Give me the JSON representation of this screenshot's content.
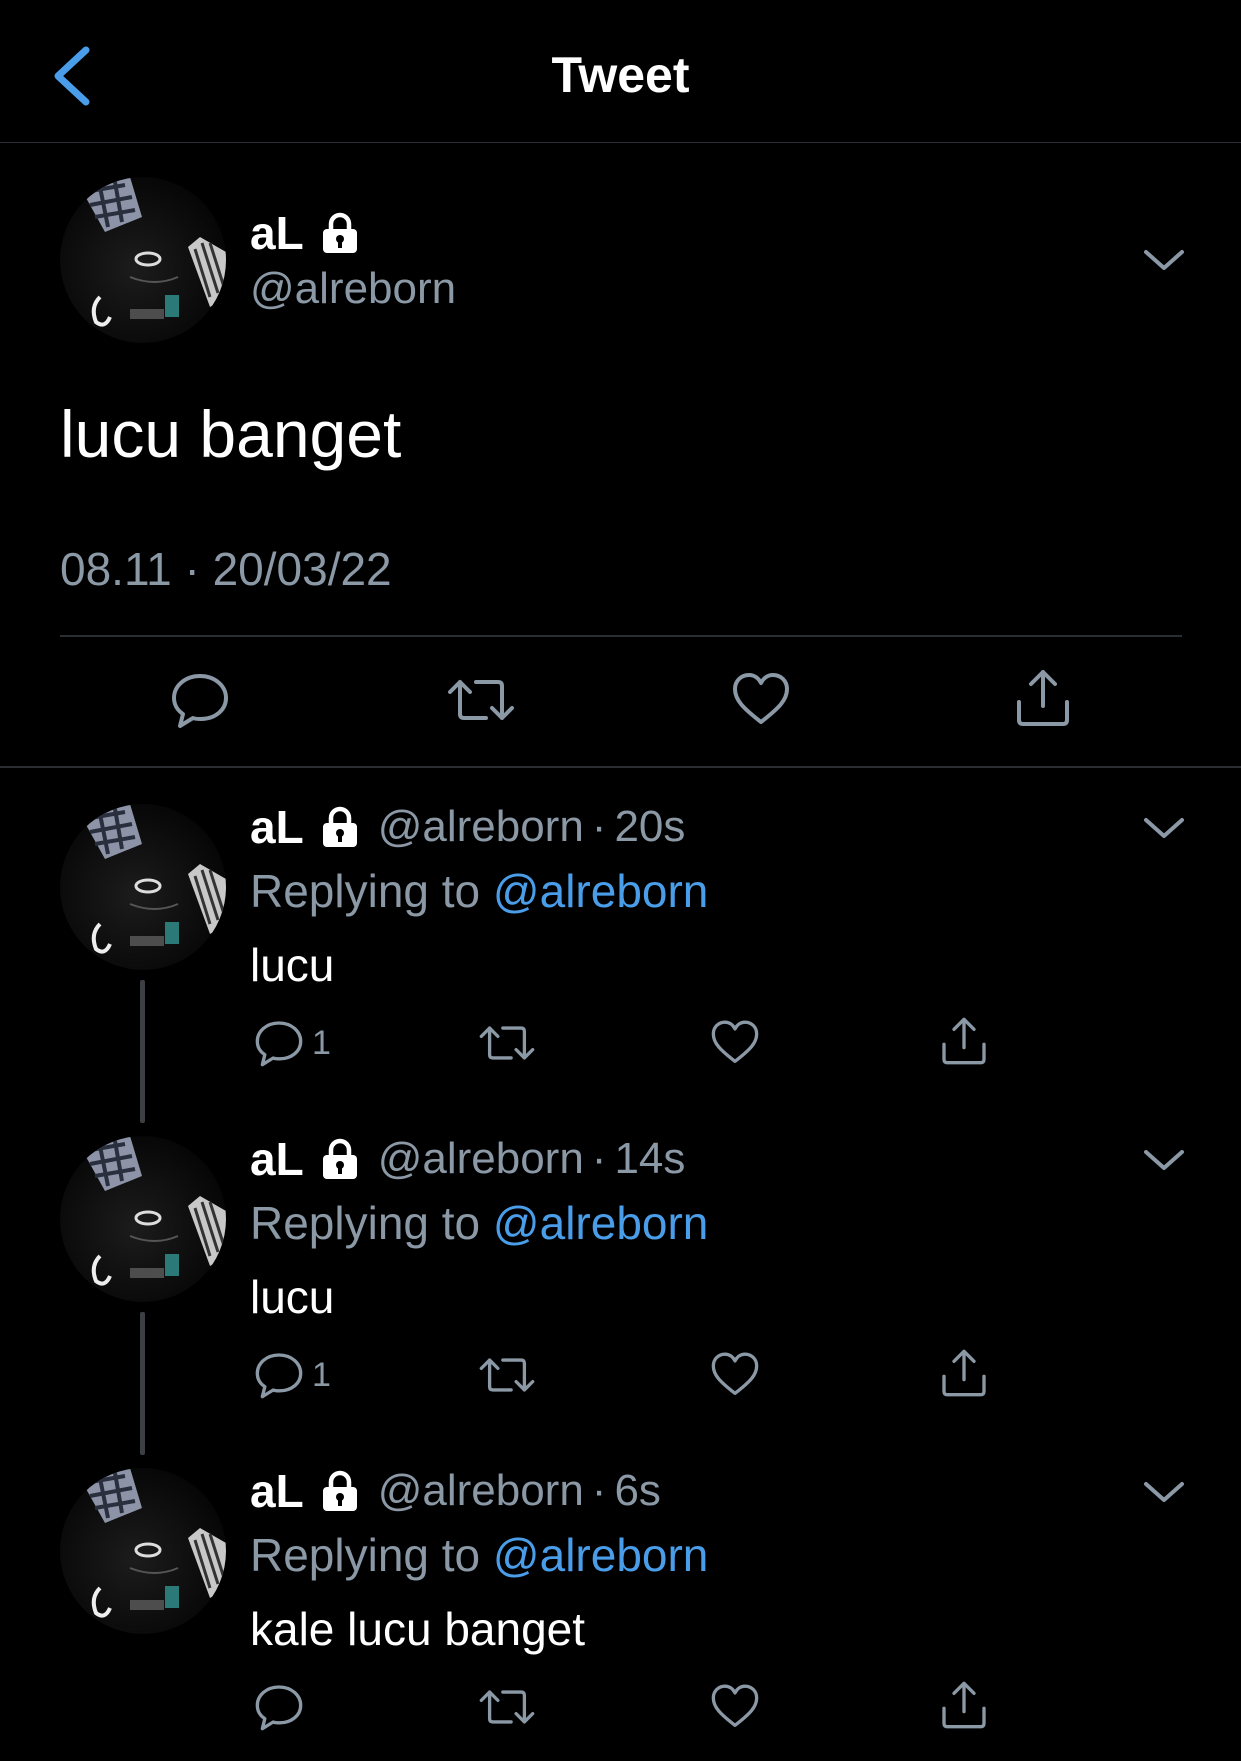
{
  "header": {
    "title": "Tweet",
    "back_icon": "chevron-left-icon",
    "accent": "#4a9de8"
  },
  "main_tweet": {
    "name": "aL",
    "handle": "@alreborn",
    "text": "lucu banget",
    "timestamp": "08.11 · 20/03/22"
  },
  "replies": [
    {
      "name": "aL",
      "handle": "@alreborn",
      "time": "20s",
      "replying_label": "Replying to",
      "mention": "@alreborn",
      "text": "lucu",
      "reply_count": "1"
    },
    {
      "name": "aL",
      "handle": "@alreborn",
      "time": "14s",
      "replying_label": "Replying to",
      "mention": "@alreborn",
      "text": "lucu",
      "reply_count": "1"
    },
    {
      "name": "aL",
      "handle": "@alreborn",
      "time": "6s",
      "replying_label": "Replying to",
      "mention": "@alreborn",
      "text": "kale lucu banget",
      "reply_count": ""
    }
  ],
  "colors": {
    "background": "#000000",
    "secondary_text": "#8b98a5",
    "link": "#4a9de8",
    "divider": "#2a2d31"
  }
}
